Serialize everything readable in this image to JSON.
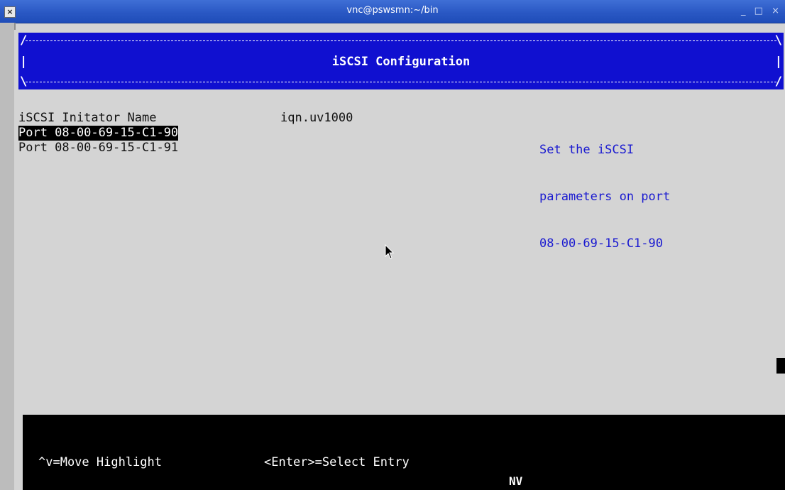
{
  "window": {
    "title": "vnc@pswsmn:~/bin",
    "close_glyph": "×",
    "controls": [
      "_",
      "□",
      "×"
    ]
  },
  "header": {
    "title": "iSCSI Configuration"
  },
  "menu": {
    "initiator_label": "iSCSI Initator Name",
    "initiator_value": "iqn.uv1000",
    "ports": [
      {
        "label": "Port 08-00-69-15-C1-90",
        "selected": true
      },
      {
        "label": "Port 08-00-69-15-C1-91",
        "selected": false
      }
    ]
  },
  "help": {
    "lines": [
      "Set the iSCSI",
      "parameters on port",
      "08-00-69-15-C1-90"
    ]
  },
  "keybar": {
    "hint_move": "^v=Move Highlight",
    "hint_select": "<Enter>=Select Entry",
    "status": "NV"
  },
  "colors": {
    "header_bg": "#1010d0",
    "help_text": "#1a1ad0",
    "titlebar": "#2a58c4"
  }
}
